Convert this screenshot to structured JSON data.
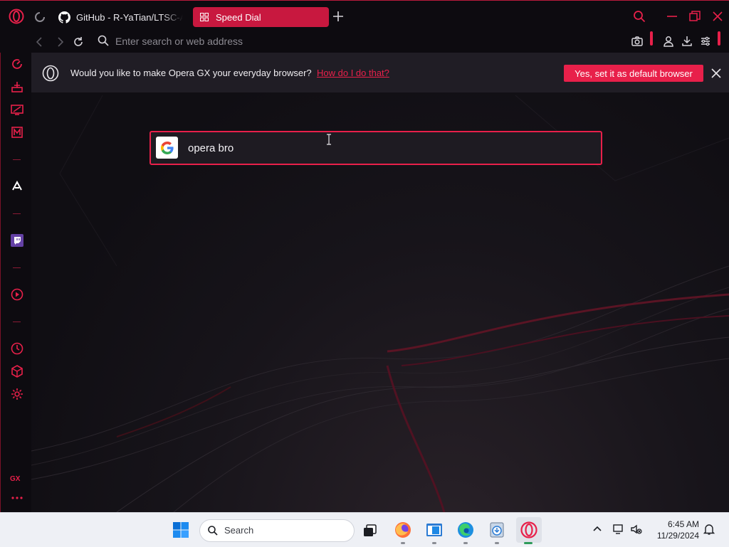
{
  "window": {
    "tabs": [
      {
        "label": "GitHub - R-YaTian/LTSC-Add-MicrosoftStore",
        "icon": "github-icon",
        "active": false
      },
      {
        "label": "Speed Dial",
        "icon": "speed-dial-grid-icon",
        "active": true
      }
    ],
    "address_bar": {
      "placeholder": "Enter search or web address",
      "value": ""
    }
  },
  "banner": {
    "message": "Would you like to make Opera GX your everyday browser?",
    "link_label": "How do I do that?",
    "button_label": "Yes, set it as default browser"
  },
  "search": {
    "value": "opera bro",
    "engine_icon": "google-icon"
  },
  "sidebar": {
    "items": [
      "gx-control-icon",
      "gx-cleaner-icon",
      "twitch-panel-icon",
      "gx-corner-icon",
      "arc-player-icon",
      "twitch-icon",
      "player-icon",
      "history-icon",
      "extensions-icon",
      "settings-icon"
    ],
    "gx_label": "GX"
  },
  "taskbar": {
    "search_label": "Search",
    "time": "6:45 AM",
    "date": "11/29/2024"
  },
  "colors": {
    "accent": "#e8204a",
    "background": "#121016",
    "banner": "#201d25",
    "taskbar": "#eef0f5"
  }
}
